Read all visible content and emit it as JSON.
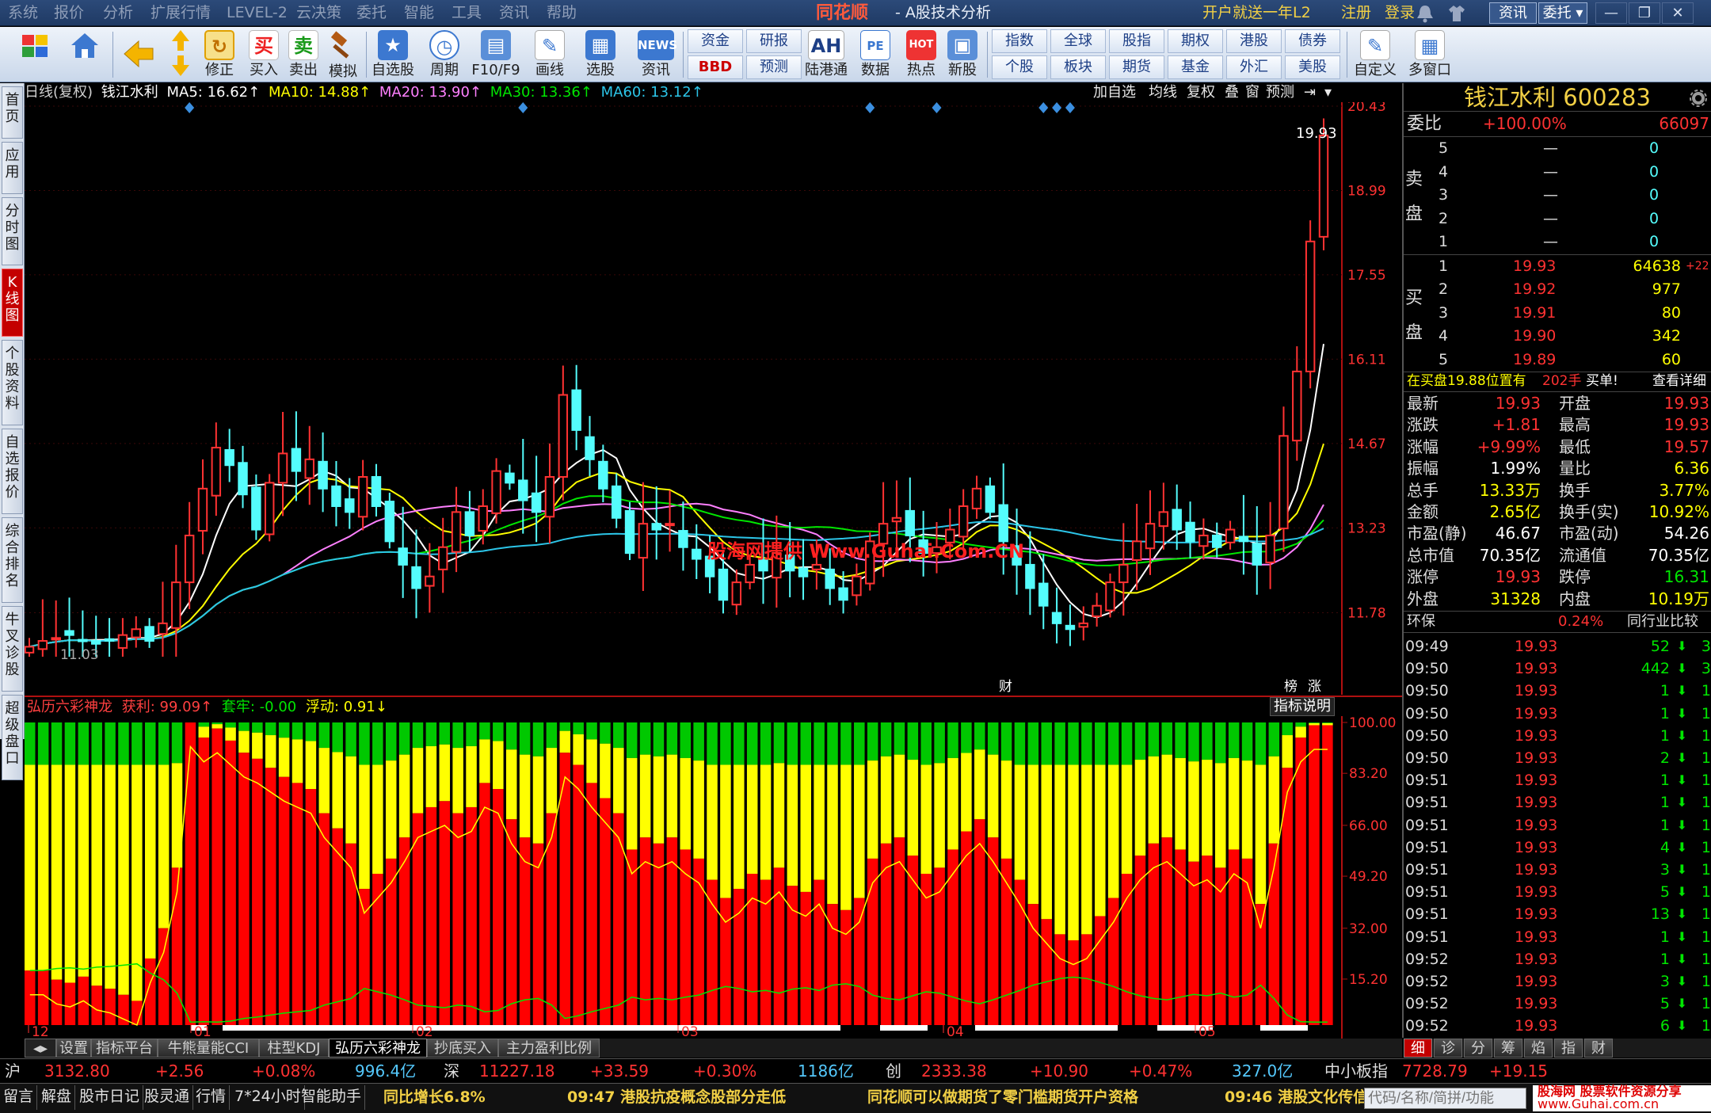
{
  "menubar": {
    "items": [
      "系统",
      "报价",
      "分析",
      "扩展行情",
      "LEVEL-2",
      "云决策",
      "委托",
      "智能",
      "工具",
      "资讯",
      "帮助"
    ],
    "brand": "同花顺",
    "subtitle": "- A股技术分析",
    "promo": "开户就送一年L2",
    "register": "注册",
    "login": "登录",
    "btn_news": "资讯",
    "btn_trade": "委托"
  },
  "toolbar": {
    "buttons": [
      "修正",
      "买入",
      "卖出",
      "模拟",
      "自选股",
      "周期",
      "F10/F9",
      "画线",
      "选股",
      "资讯",
      "陆港通",
      "数据",
      "热点",
      "新股",
      "自定义",
      "多窗口"
    ],
    "grid_top": [
      "资金",
      "研报",
      "指数",
      "全球",
      "股指",
      "期权",
      "港股",
      "债券"
    ],
    "grid_bottom": [
      "BBD",
      "预测",
      "个股",
      "板块",
      "期货",
      "基金",
      "外汇",
      "美股"
    ],
    "icon_buy": "买",
    "icon_sell": "卖",
    "icon_news": "NEWS",
    "icon_ah": "AH",
    "icon_pe": "PE",
    "icon_hot": "HOT"
  },
  "leftnav": [
    "首页",
    "应用",
    "分时图",
    "K线图",
    "个股资料",
    "自选报价",
    "综合排名",
    "牛叉诊股",
    "超级盘口"
  ],
  "kline": {
    "period": "日线(复权)",
    "name": "钱江水利",
    "ma5": "MA5: 16.62↑",
    "ma10": "MA10: 14.88↑",
    "ma20": "MA20: 13.90↑",
    "ma30": "MA30: 13.36↑",
    "ma60": "MA60: 13.12↑",
    "controls": [
      "加自选",
      "均线",
      "复权",
      "叠",
      "窗",
      "预测"
    ],
    "price_labels": [
      "20.43",
      "18.99",
      "17.55",
      "16.11",
      "14.67",
      "13.23",
      "11.78"
    ],
    "last_price": "19.93",
    "low_price": "11.03",
    "markers": [
      "财",
      "榜",
      "涨"
    ],
    "watermark": "股海网提供 Www.Guhai.Com.CN"
  },
  "indicator": {
    "name": "弘历六彩神龙",
    "profit": "获利: 99.09↑",
    "trapped": "套牢: -0.00",
    "float": "浮动: 0.91↓",
    "explain": "指标说明",
    "scale": [
      "100.00",
      "83.20",
      "66.00",
      "49.20",
      "32.00",
      "15.20"
    ],
    "months": [
      "12",
      "01",
      "02",
      "03",
      "04",
      "05"
    ]
  },
  "colors": {
    "up": "#ff3232",
    "down": "#54fcfc",
    "ma5": "#ffffff",
    "ma10": "#ffff00",
    "ma20": "#ff80ff",
    "ma30": "#00e600",
    "ma60": "#2cc5e8",
    "yellow": "#f2d045"
  },
  "chart_data": {
    "type": "candlestick",
    "title": "钱江水利 日线(复权)",
    "ylim": [
      11.03,
      20.43
    ],
    "close_series": [
      11.2,
      11.3,
      11.35,
      11.4,
      11.3,
      11.25,
      11.3,
      11.4,
      11.5,
      11.3,
      11.6,
      12.3,
      13.1,
      13.9,
      14.6,
      14.3,
      13.8,
      13.2,
      14.0,
      14.5,
      14.2,
      14.4,
      13.9,
      13.6,
      13.5,
      14.1,
      13.6,
      13.0,
      12.6,
      12.2,
      12.4,
      12.9,
      13.5,
      13.1,
      13.6,
      14.2,
      14.0,
      13.7,
      13.5,
      14.1,
      15.5,
      14.9,
      14.4,
      13.9,
      13.4,
      12.8,
      13.3,
      13.2,
      13.3,
      12.9,
      12.7,
      12.4,
      12.0,
      12.3,
      12.6,
      12.5,
      12.8,
      12.5,
      12.4,
      12.6,
      12.2,
      12.0,
      12.4,
      13.0,
      13.3,
      13.4,
      13.1,
      12.8,
      12.9,
      13.2,
      13.6,
      13.9,
      13.5,
      13.0,
      12.6,
      12.2,
      11.9,
      11.6,
      11.5,
      11.6,
      11.9,
      12.3,
      12.6,
      13.0,
      13.3,
      13.5,
      13.2,
      13.0,
      13.1,
      12.9,
      13.2,
      13.0,
      12.6,
      13.1,
      14.8,
      15.9,
      18.12,
      19.93
    ],
    "ma5_last": 16.62,
    "ma10_last": 14.88,
    "ma20_last": 13.9,
    "ma30_last": 13.36,
    "ma60_last": 13.12,
    "indicator_profit": [
      18,
      18,
      15,
      14,
      16,
      13,
      12,
      10,
      8,
      22,
      32,
      52,
      100,
      95,
      98,
      94,
      90,
      88,
      85,
      82,
      80,
      78,
      70,
      65,
      60,
      45,
      50,
      55,
      62,
      70,
      72,
      74,
      70,
      72,
      80,
      78,
      68,
      62,
      60,
      70,
      90,
      86,
      80,
      75,
      70,
      58,
      62,
      60,
      62,
      58,
      55,
      48,
      42,
      45,
      50,
      48,
      52,
      46,
      44,
      48,
      40,
      38,
      42,
      55,
      60,
      62,
      56,
      50,
      52,
      58,
      64,
      68,
      62,
      55,
      48,
      40,
      35,
      30,
      28,
      30,
      36,
      42,
      50,
      56,
      60,
      62,
      58,
      54,
      56,
      52,
      58,
      55,
      40,
      60,
      85,
      95,
      99.09,
      99.09
    ]
  },
  "quote": {
    "title": "钱江水利 600283",
    "weibi_label": "委比",
    "weibi_val": "+100.00%",
    "weicha": "66097",
    "sell_label": "卖盘",
    "buy_label": "买盘",
    "sell": [
      {
        "lv": "5",
        "p": "—",
        "v": "0"
      },
      {
        "lv": "4",
        "p": "—",
        "v": "0"
      },
      {
        "lv": "3",
        "p": "—",
        "v": "0"
      },
      {
        "lv": "2",
        "p": "—",
        "v": "0"
      },
      {
        "lv": "1",
        "p": "—",
        "v": "0"
      }
    ],
    "buy": [
      {
        "lv": "1",
        "p": "19.93",
        "v": "64638",
        "x": "+22"
      },
      {
        "lv": "2",
        "p": "19.92",
        "v": "977",
        "x": ""
      },
      {
        "lv": "3",
        "p": "19.91",
        "v": "80",
        "x": ""
      },
      {
        "lv": "4",
        "p": "19.90",
        "v": "342",
        "x": ""
      },
      {
        "lv": "5",
        "p": "19.89",
        "v": "60",
        "x": ""
      }
    ],
    "notice": "在买盘19.88位置有",
    "notice_qty": "202手",
    "notice_tag": "买单!",
    "notice_link": "查看详细",
    "stats": [
      {
        "l1": "最新",
        "v1": "19.93",
        "l2": "开盘",
        "v2": "19.93"
      },
      {
        "l1": "涨跌",
        "v1": "+1.81",
        "l2": "最高",
        "v2": "19.93"
      },
      {
        "l1": "涨幅",
        "v1": "+9.99%",
        "l2": "最低",
        "v2": "19.57"
      },
      {
        "l1": "振幅",
        "v1": "1.99%",
        "l2": "量比",
        "v2": "6.36"
      },
      {
        "l1": "总手",
        "v1": "13.33万",
        "l2": "换手",
        "v2": "3.77%"
      },
      {
        "l1": "金额",
        "v1": "2.65亿",
        "l2": "换手(实)",
        "v2": "10.92%"
      },
      {
        "l1": "市盈(静)",
        "v1": "46.67",
        "l2": "市盈(动)",
        "v2": "54.26"
      },
      {
        "l1": "总市值",
        "v1": "70.35亿",
        "l2": "流通值",
        "v2": "70.35亿"
      },
      {
        "l1": "涨停",
        "v1": "19.93",
        "l2": "跌停",
        "v2": "16.31"
      },
      {
        "l1": "外盘",
        "v1": "31328",
        "l2": "内盘",
        "v2": "10.19万"
      }
    ],
    "huanbao": "环保",
    "huanbao_pct": "0.24%",
    "compare": "同行业比较",
    "ticks": [
      {
        "t": "09:49",
        "p": "19.93",
        "v": "52",
        "n": "3"
      },
      {
        "t": "09:50",
        "p": "19.93",
        "v": "442",
        "n": "3"
      },
      {
        "t": "09:50",
        "p": "19.93",
        "v": "1",
        "n": "1"
      },
      {
        "t": "09:50",
        "p": "19.93",
        "v": "1",
        "n": "1"
      },
      {
        "t": "09:50",
        "p": "19.93",
        "v": "1",
        "n": "1"
      },
      {
        "t": "09:50",
        "p": "19.93",
        "v": "2",
        "n": "1"
      },
      {
        "t": "09:51",
        "p": "19.93",
        "v": "1",
        "n": "1"
      },
      {
        "t": "09:51",
        "p": "19.93",
        "v": "1",
        "n": "1"
      },
      {
        "t": "09:51",
        "p": "19.93",
        "v": "1",
        "n": "1"
      },
      {
        "t": "09:51",
        "p": "19.93",
        "v": "4",
        "n": "1"
      },
      {
        "t": "09:51",
        "p": "19.93",
        "v": "3",
        "n": "1"
      },
      {
        "t": "09:51",
        "p": "19.93",
        "v": "5",
        "n": "1"
      },
      {
        "t": "09:51",
        "p": "19.93",
        "v": "13",
        "n": "1"
      },
      {
        "t": "09:51",
        "p": "19.93",
        "v": "1",
        "n": "1"
      },
      {
        "t": "09:52",
        "p": "19.93",
        "v": "1",
        "n": "1"
      },
      {
        "t": "09:52",
        "p": "19.93",
        "v": "3",
        "n": "1"
      },
      {
        "t": "09:52",
        "p": "19.93",
        "v": "5",
        "n": "1"
      },
      {
        "t": "09:52",
        "p": "19.93",
        "v": "6",
        "n": "1"
      }
    ],
    "tabs": [
      "细",
      "诊",
      "分",
      "筹",
      "焰",
      "指",
      "财"
    ]
  },
  "bottom_tabs": [
    "设置",
    "指标平台",
    "牛熊量能CCI",
    "柱型KDJ",
    "弘历六彩神龙",
    "抄底买入",
    "主力盈利比例"
  ],
  "index_bar": {
    "sh": {
      "name": "沪",
      "val": "3132.80",
      "chg": "+2.56",
      "pct": "+0.08%",
      "amt": "996.4亿"
    },
    "sz": {
      "name": "深",
      "val": "11227.18",
      "chg": "+33.59",
      "pct": "+0.30%",
      "amt": "1186亿"
    },
    "cy": {
      "name": "创",
      "val": "2333.38",
      "chg": "+10.90",
      "pct": "+0.47%",
      "amt": "327.0亿"
    },
    "zxb": {
      "name": "中小板指",
      "val": "7728.79",
      "chg": "+19.15"
    }
  },
  "news_bar": {
    "buttons": [
      "留言",
      "解盘",
      "股市日记",
      "股灵通",
      "行情",
      "7*24小时",
      "智能助手"
    ],
    "news1": "同比增长6.8%",
    "news2": "09:47 港股抗疫概念股部分走低",
    "news3": "同花顺可以做期货了零门槛期货开户资格",
    "news4": "09:46 港股文化传信跌",
    "code_placeholder": "代码/名称/简拼/功能",
    "wm_top": "股海网 股票软件资源分享",
    "wm_bottom": "www.Guhai.com.cn"
  }
}
